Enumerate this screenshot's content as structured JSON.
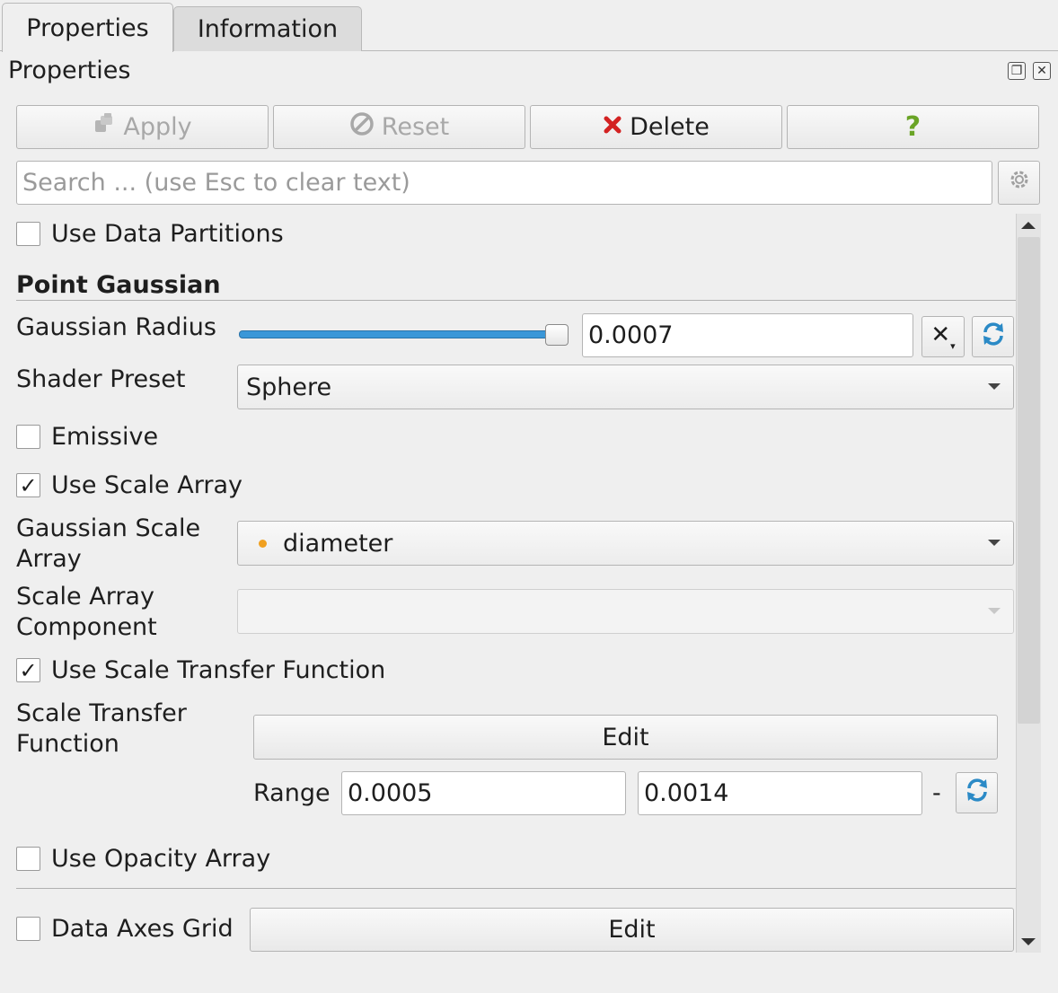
{
  "tabs": [
    {
      "label": "Properties",
      "active": true
    },
    {
      "label": "Information",
      "active": false
    }
  ],
  "panel": {
    "title": "Properties",
    "float_icon": "float-icon",
    "close_icon": "close-icon"
  },
  "toolbar": {
    "apply_label": "Apply",
    "apply_icon": "apply-icon",
    "reset_label": "Reset",
    "reset_icon": "reset-icon",
    "delete_label": "Delete",
    "delete_icon": "delete-icon",
    "help_label": "?",
    "delete_icon_color": "#d32222",
    "help_color": "#6aa426"
  },
  "search": {
    "placeholder": "Search ... (use Esc to clear text)",
    "value": "",
    "settings_icon": "gear-icon"
  },
  "props": {
    "use_data_partitions": {
      "label": "Use Data Partitions",
      "checked": false
    },
    "section_title": "Point Gaussian",
    "gaussian_radius": {
      "label": "Gaussian Radius",
      "value": "0.0007",
      "slider_fraction": 1.0
    },
    "shader_preset": {
      "label": "Shader Preset",
      "value": "Sphere"
    },
    "emissive": {
      "label": "Emissive",
      "checked": false
    },
    "use_scale_array": {
      "label": "Use Scale Array",
      "checked": true
    },
    "gaussian_scale_array": {
      "label_line1": "Gaussian Scale",
      "label_line2": "Array",
      "value": "diameter",
      "dot_color": "#f0a020"
    },
    "scale_array_component": {
      "label_line1": "Scale Array",
      "label_line2": "Component",
      "value": ""
    },
    "use_scale_transfer_function": {
      "label": "Use Scale Transfer Function",
      "checked": true
    },
    "scale_transfer_function": {
      "label_line1": "Scale Transfer",
      "label_line2": "Function",
      "edit_label": "Edit"
    },
    "range": {
      "label": "Range",
      "min": "0.0005",
      "max": "0.0014",
      "dash": "-"
    },
    "use_opacity_array": {
      "label": "Use Opacity Array",
      "checked": false
    },
    "data_axes_grid": {
      "label": "Data Axes Grid",
      "checked": false,
      "edit_label": "Edit"
    }
  },
  "colors": {
    "accent": "#3a97d8",
    "refresh": "#2b8ac6"
  }
}
